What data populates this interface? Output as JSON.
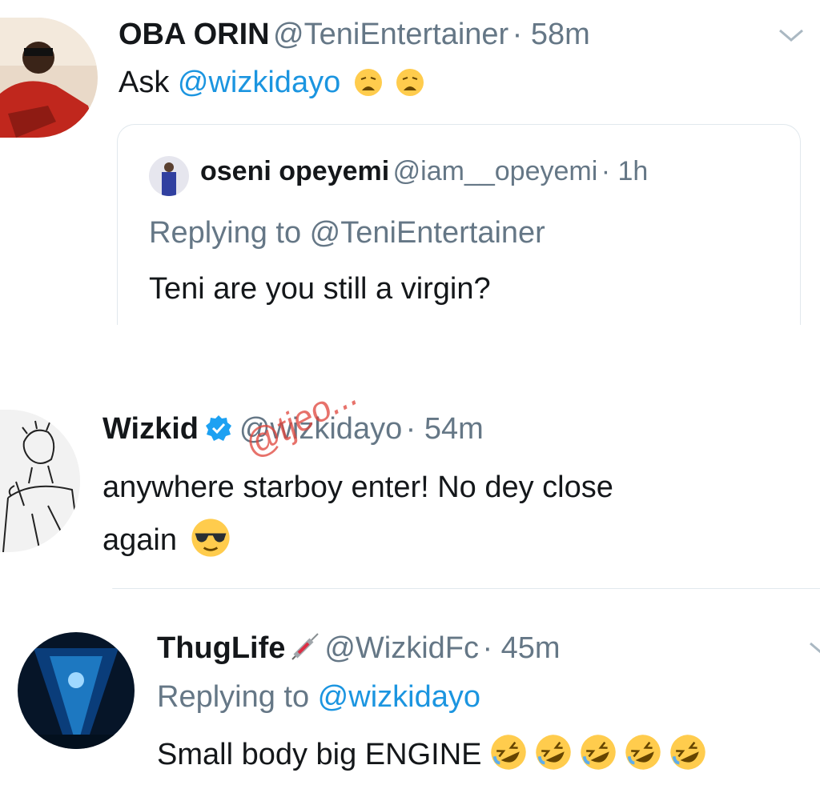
{
  "tweet1": {
    "name": "OBA ORIN",
    "handle": "@TeniEntertainer",
    "time": "· 58m",
    "text_prefix": "Ask ",
    "mention": "@wizkidayo",
    "emojis": [
      "weary-face-emoji",
      "weary-face-emoji"
    ],
    "quoted": {
      "name": "oseni opeyemi",
      "handle": "@iam__opeyemi",
      "time": "· 1h",
      "replying_label": "Replying to ",
      "replying_handle": "@TeniEntertainer",
      "text": "Teni are you still a virgin?"
    }
  },
  "tweet2": {
    "name": "Wizkid",
    "handle": "@wizkidayo",
    "time": "· 54m",
    "text_line1": "anywhere starboy enter! No dey close",
    "text_line2": "again",
    "emoji": "sunglasses-emoji"
  },
  "tweet3": {
    "name": "ThugLife",
    "handle": "@WizkidFc",
    "time": "· 45m",
    "replying_label": "Replying to ",
    "replying_handle": "@wizkidayo",
    "text": "Small body big ENGINE",
    "emojis": [
      "rofl-emoji",
      "rofl-emoji",
      "rofl-emoji",
      "rofl-emoji",
      "rofl-emoji"
    ]
  },
  "watermark": "@tjeo...",
  "colors": {
    "link": "#1b95e0",
    "muted": "#657786",
    "verified": "#1da1f2"
  }
}
